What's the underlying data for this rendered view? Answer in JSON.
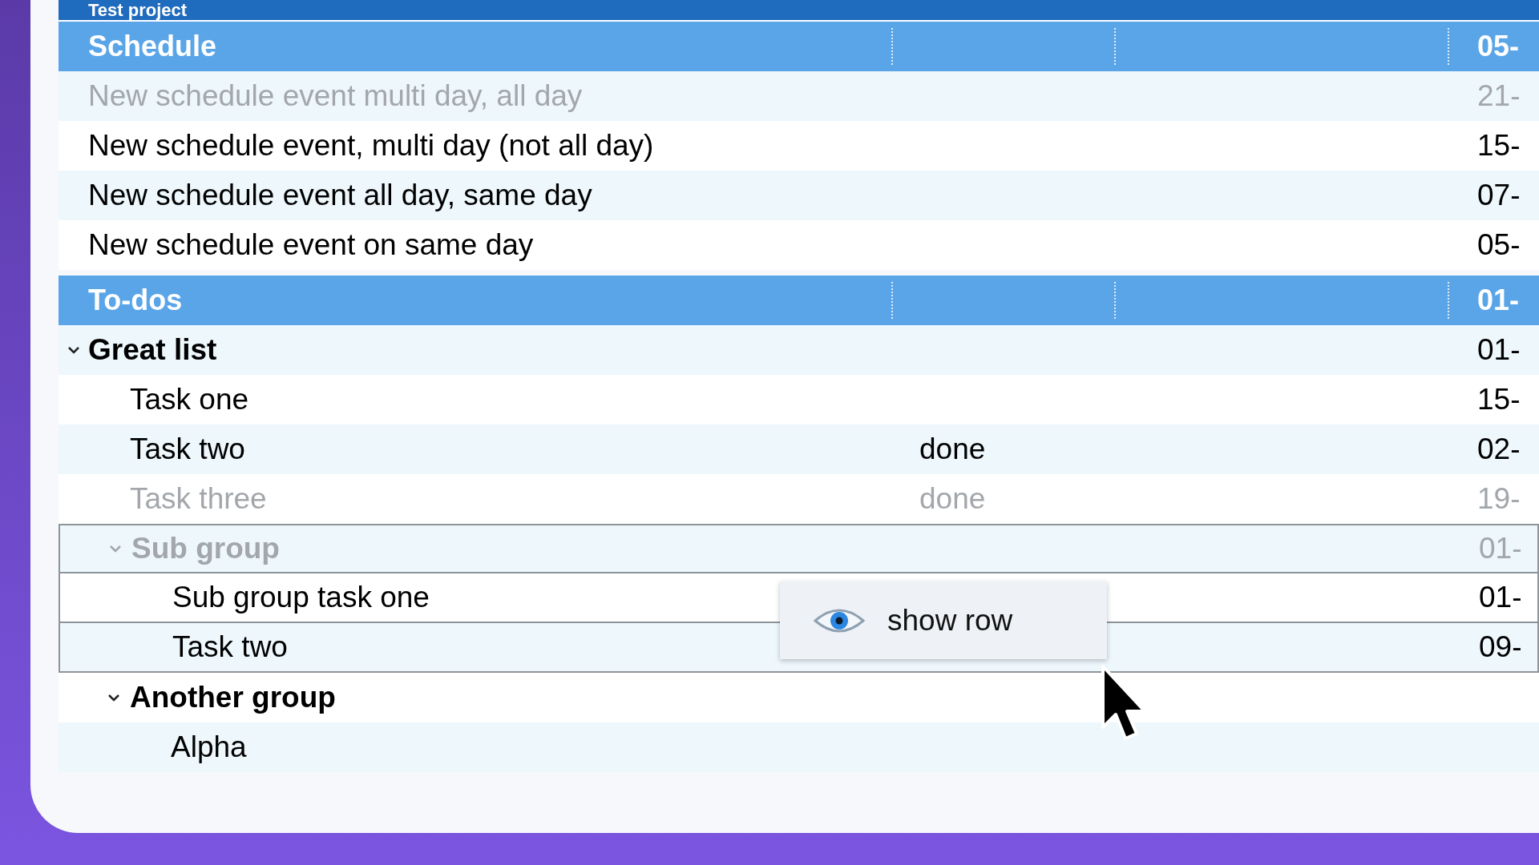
{
  "title": "Test project",
  "sections": [
    {
      "title": "Schedule",
      "date": "05-",
      "rows": [
        {
          "kind": "item",
          "name": "New schedule event multi day, all day",
          "date": "21-",
          "dimmed": true
        },
        {
          "kind": "item",
          "name": "New schedule event, multi day (not all day)",
          "date": "15-",
          "dimmed": false
        },
        {
          "kind": "item",
          "name": "New schedule event all day, same day",
          "date": "07-",
          "dimmed": false
        },
        {
          "kind": "item",
          "name": "New schedule event on same day",
          "date": "05-",
          "dimmed": false
        }
      ]
    },
    {
      "title": "To-dos",
      "date": "01-",
      "rows": [
        {
          "kind": "group",
          "name": "Great list",
          "date": "01-",
          "dimmed": false,
          "expanded": true,
          "children": [
            {
              "kind": "item",
              "name": "Task one",
              "date": "15-",
              "dimmed": false
            },
            {
              "kind": "item",
              "name": "Task two",
              "status": "done",
              "date": "02-",
              "dimmed": false
            },
            {
              "kind": "item",
              "name": "Task three",
              "status": "done",
              "date": "19-",
              "dimmed": true
            },
            {
              "kind": "group",
              "name": "Sub group",
              "date": "01-",
              "dimmed": true,
              "boxed": true,
              "expanded": true,
              "children": [
                {
                  "kind": "item",
                  "name": "Sub group task one",
                  "date": "01-",
                  "dimmed": false,
                  "boxed": true
                },
                {
                  "kind": "item",
                  "name": "Task two",
                  "date": "09-",
                  "dimmed": false,
                  "boxed": true
                }
              ]
            },
            {
              "kind": "group",
              "name": "Another group",
              "dimmed": false,
              "expanded": true,
              "children": [
                {
                  "kind": "item",
                  "name": "Alpha",
                  "dimmed": false
                }
              ]
            }
          ]
        }
      ]
    }
  ],
  "popup": {
    "label": "show row"
  }
}
